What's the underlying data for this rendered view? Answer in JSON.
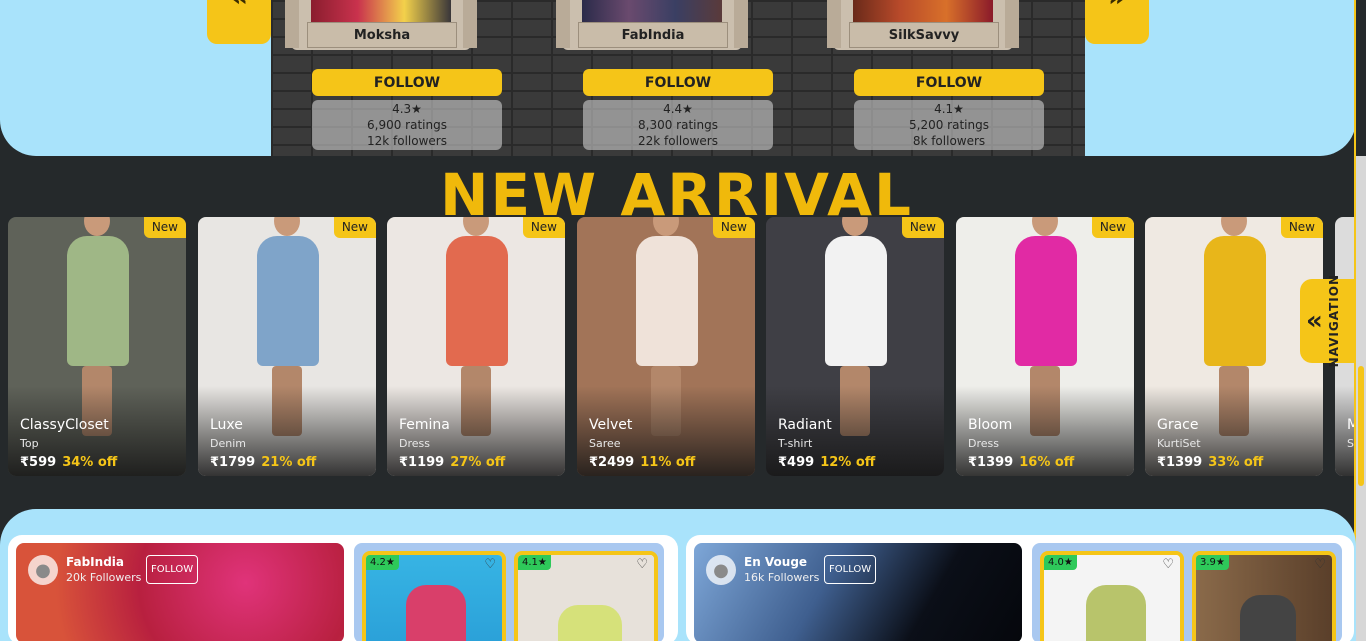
{
  "top": {
    "stores": [
      {
        "name": "Moksha",
        "follow": "FOLLOW",
        "rating": "4.3★",
        "ratings": "6,900 ratings",
        "followers": "12k followers"
      },
      {
        "name": "FabIndia",
        "follow": "FOLLOW",
        "rating": "4.4★",
        "ratings": "8,300 ratings",
        "followers": "22k followers"
      },
      {
        "name": "SilkSavvy",
        "follow": "FOLLOW",
        "rating": "4.1★",
        "ratings": "5,200 ratings",
        "followers": "8k followers"
      }
    ],
    "prev_icon": "double-chevron-left-icon",
    "next_icon": "double-chevron-right-icon",
    "prev_glyph": "«",
    "next_glyph": "»"
  },
  "arrival": {
    "title": "NEW ARRIVAL",
    "badge": "New",
    "cards": [
      {
        "brand": "ClassyCloset",
        "type": "Top",
        "price": "₹599",
        "discount": "34% off",
        "bg": "#5f6259",
        "outfit": "#9fb786"
      },
      {
        "brand": "Luxe",
        "type": "Denim",
        "price": "₹1799",
        "discount": "21% off",
        "bg": "#e8e6e3",
        "outfit": "#7fa4c9"
      },
      {
        "brand": "Femina",
        "type": "Dress",
        "price": "₹1199",
        "discount": "27% off",
        "bg": "#ece7e3",
        "outfit": "#e26a4f"
      },
      {
        "brand": "Velvet",
        "type": "Saree",
        "price": "₹2499",
        "discount": "11% off",
        "bg": "#a27458",
        "outfit": "#efe2d9"
      },
      {
        "brand": "Radiant",
        "type": "T-shirt",
        "price": "₹499",
        "discount": "12% off",
        "bg": "#3f3f45",
        "outfit": "#f2f2f2"
      },
      {
        "brand": "Bloom",
        "type": "Dress",
        "price": "₹1399",
        "discount": "16% off",
        "bg": "#eeeeea",
        "outfit": "#e12aa4"
      },
      {
        "brand": "Grace",
        "type": "KurtiSet",
        "price": "₹1399",
        "discount": "33% off",
        "bg": "#efe9e2",
        "outfit": "#e8b61a"
      },
      {
        "brand": "M",
        "type": "S",
        "price": "",
        "discount": "",
        "bg": "#dcdcdc",
        "outfit": "#cccccc"
      }
    ]
  },
  "side_nav": {
    "label": "NAVIGATION",
    "icon": "double-chevron-left-icon",
    "glyph": "«"
  },
  "bottom": {
    "panels": [
      {
        "name": "FabIndia",
        "followers": "20k Followers",
        "follow": "FOLLOW",
        "color": "#c9284f",
        "items": [
          {
            "rating": "4.2★",
            "color": "#d93f6a"
          },
          {
            "rating": "4.1★",
            "color": "#d6e17a"
          }
        ]
      },
      {
        "name": "En Vouge",
        "followers": "16k Followers",
        "follow": "FOLLOW",
        "color": "#3a4a6b",
        "items": [
          {
            "rating": "4.0★",
            "color": "#b8c46b"
          },
          {
            "rating": "3.9★",
            "color": "#6a4a3a"
          }
        ]
      }
    ],
    "heart_icon": "heart-icon",
    "heart_glyph": "♡",
    "avatar_icon": "user-avatar-icon",
    "avatar_glyph": "●"
  },
  "colors": {
    "accent": "#f5c518",
    "sky": "#a9e3fb",
    "dark": "#25292b",
    "title": "#f0b90b"
  }
}
